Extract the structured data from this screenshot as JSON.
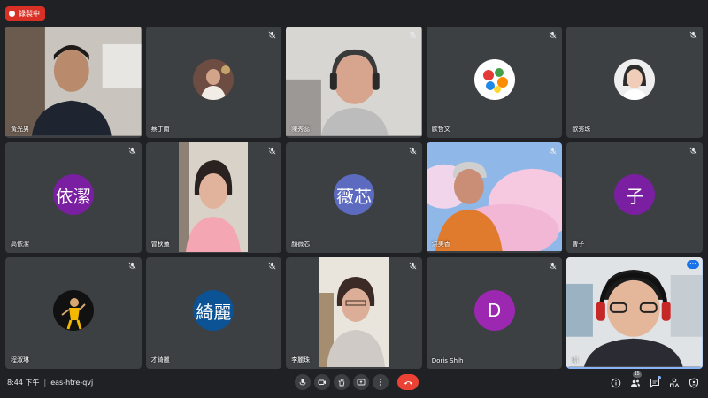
{
  "recording": {
    "label": "錄製中",
    "color": "#d93025"
  },
  "meeting": {
    "time": "8:44 下午",
    "separator": "|",
    "code": "eas-htre-qvj"
  },
  "participants": [
    {
      "name": "黃光男",
      "type": "video",
      "muted": false
    },
    {
      "name": "蔡丁南",
      "type": "photo",
      "muted": true
    },
    {
      "name": "陳秀蕊",
      "type": "video",
      "muted": true
    },
    {
      "name": "歐哲文",
      "type": "logo",
      "muted": true
    },
    {
      "name": "歐秀珠",
      "type": "photo",
      "muted": true
    },
    {
      "name": "高依潔",
      "type": "initials",
      "initials": "依潔",
      "color": "#7b1fa2",
      "muted": true
    },
    {
      "name": "曾秋蓮",
      "type": "video-portrait",
      "muted": true
    },
    {
      "name": "顏薇芯",
      "type": "initials",
      "initials": "薇芯",
      "color": "#5c6bc0",
      "muted": true
    },
    {
      "name": "洪美香",
      "type": "video",
      "muted": true
    },
    {
      "name": "曹子",
      "type": "initials",
      "initials": "子",
      "color": "#7b1fa2",
      "muted": true
    },
    {
      "name": "程淑琳",
      "type": "photo-dark",
      "muted": true
    },
    {
      "name": "才綺麗",
      "type": "initials",
      "initials": "綺麗",
      "color": "#0b5394",
      "muted": true
    },
    {
      "name": "李麗珠",
      "type": "video-portrait",
      "muted": true
    },
    {
      "name": "Doris Shih",
      "type": "initials",
      "initials": "D",
      "color": "#9c27b0",
      "muted": true
    },
    {
      "name": "你",
      "type": "video-self",
      "muted": false
    }
  ],
  "toolbar": {
    "buttons": [
      "mic-icon",
      "camera-icon",
      "raise-hand-icon",
      "present-icon",
      "more-options-icon"
    ],
    "end_call": "end-call-icon"
  },
  "right_tools": {
    "participants_count": "15"
  },
  "colors": {
    "background": "#202124",
    "tile": "#3c4043",
    "accent": "#8ab4f8",
    "end_call": "#ea4335"
  }
}
